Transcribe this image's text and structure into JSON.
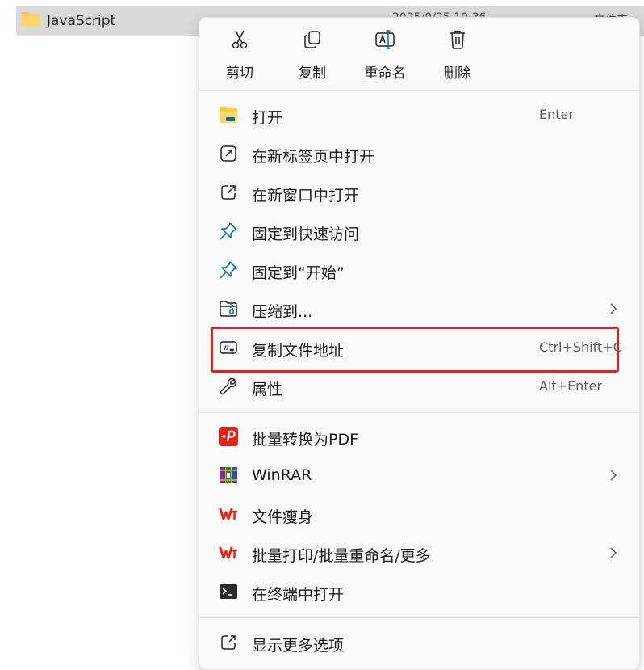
{
  "file": {
    "name": "JavaScript",
    "date_partial": "2025/9/25 10:36",
    "type_partial": "文件夹"
  },
  "toolbar": [
    {
      "label": "剪切",
      "icon": "scissors-icon"
    },
    {
      "label": "复制",
      "icon": "copy-icon"
    },
    {
      "label": "重命名",
      "icon": "rename-icon"
    },
    {
      "label": "删除",
      "icon": "trash-icon"
    }
  ],
  "menu": {
    "items": [
      {
        "label": "打开",
        "shortcut": "Enter",
        "icon": "folder-icon"
      },
      {
        "label": "在新标签页中打开",
        "shortcut": "",
        "icon": "open-new-tab-icon"
      },
      {
        "label": "在新窗口中打开",
        "shortcut": "",
        "icon": "open-new-window-icon"
      },
      {
        "label": "固定到快速访问",
        "shortcut": "",
        "icon": "pin-icon"
      },
      {
        "label": "固定到“开始”",
        "shortcut": "",
        "icon": "pin-icon"
      },
      {
        "label": "压缩到...",
        "shortcut": "",
        "icon": "zip-folder-icon",
        "submenu": true
      },
      {
        "label": "复制文件地址",
        "shortcut": "Ctrl+Shift+C",
        "icon": "copy-path-icon"
      },
      {
        "label": "属性",
        "shortcut": "Alt+Enter",
        "icon": "wrench-icon"
      }
    ],
    "ext_items": [
      {
        "label": "批量转换为PDF",
        "icon": "pdf-convert-icon"
      },
      {
        "label": "WinRAR",
        "icon": "winrar-icon",
        "submenu": true
      },
      {
        "label": "文件瘦身",
        "icon": "wps-icon"
      },
      {
        "label": "批量打印/批量重命名/更多",
        "icon": "wps-icon",
        "submenu": true
      },
      {
        "label": "在终端中打开",
        "icon": "terminal-icon"
      }
    ],
    "more": {
      "label": "显示更多选项",
      "icon": "show-more-icon"
    }
  },
  "colors": {
    "highlight": "#e8201a",
    "folder": "#ffc83d",
    "accent": "#0067c0",
    "wps_red": "#e8201a"
  }
}
